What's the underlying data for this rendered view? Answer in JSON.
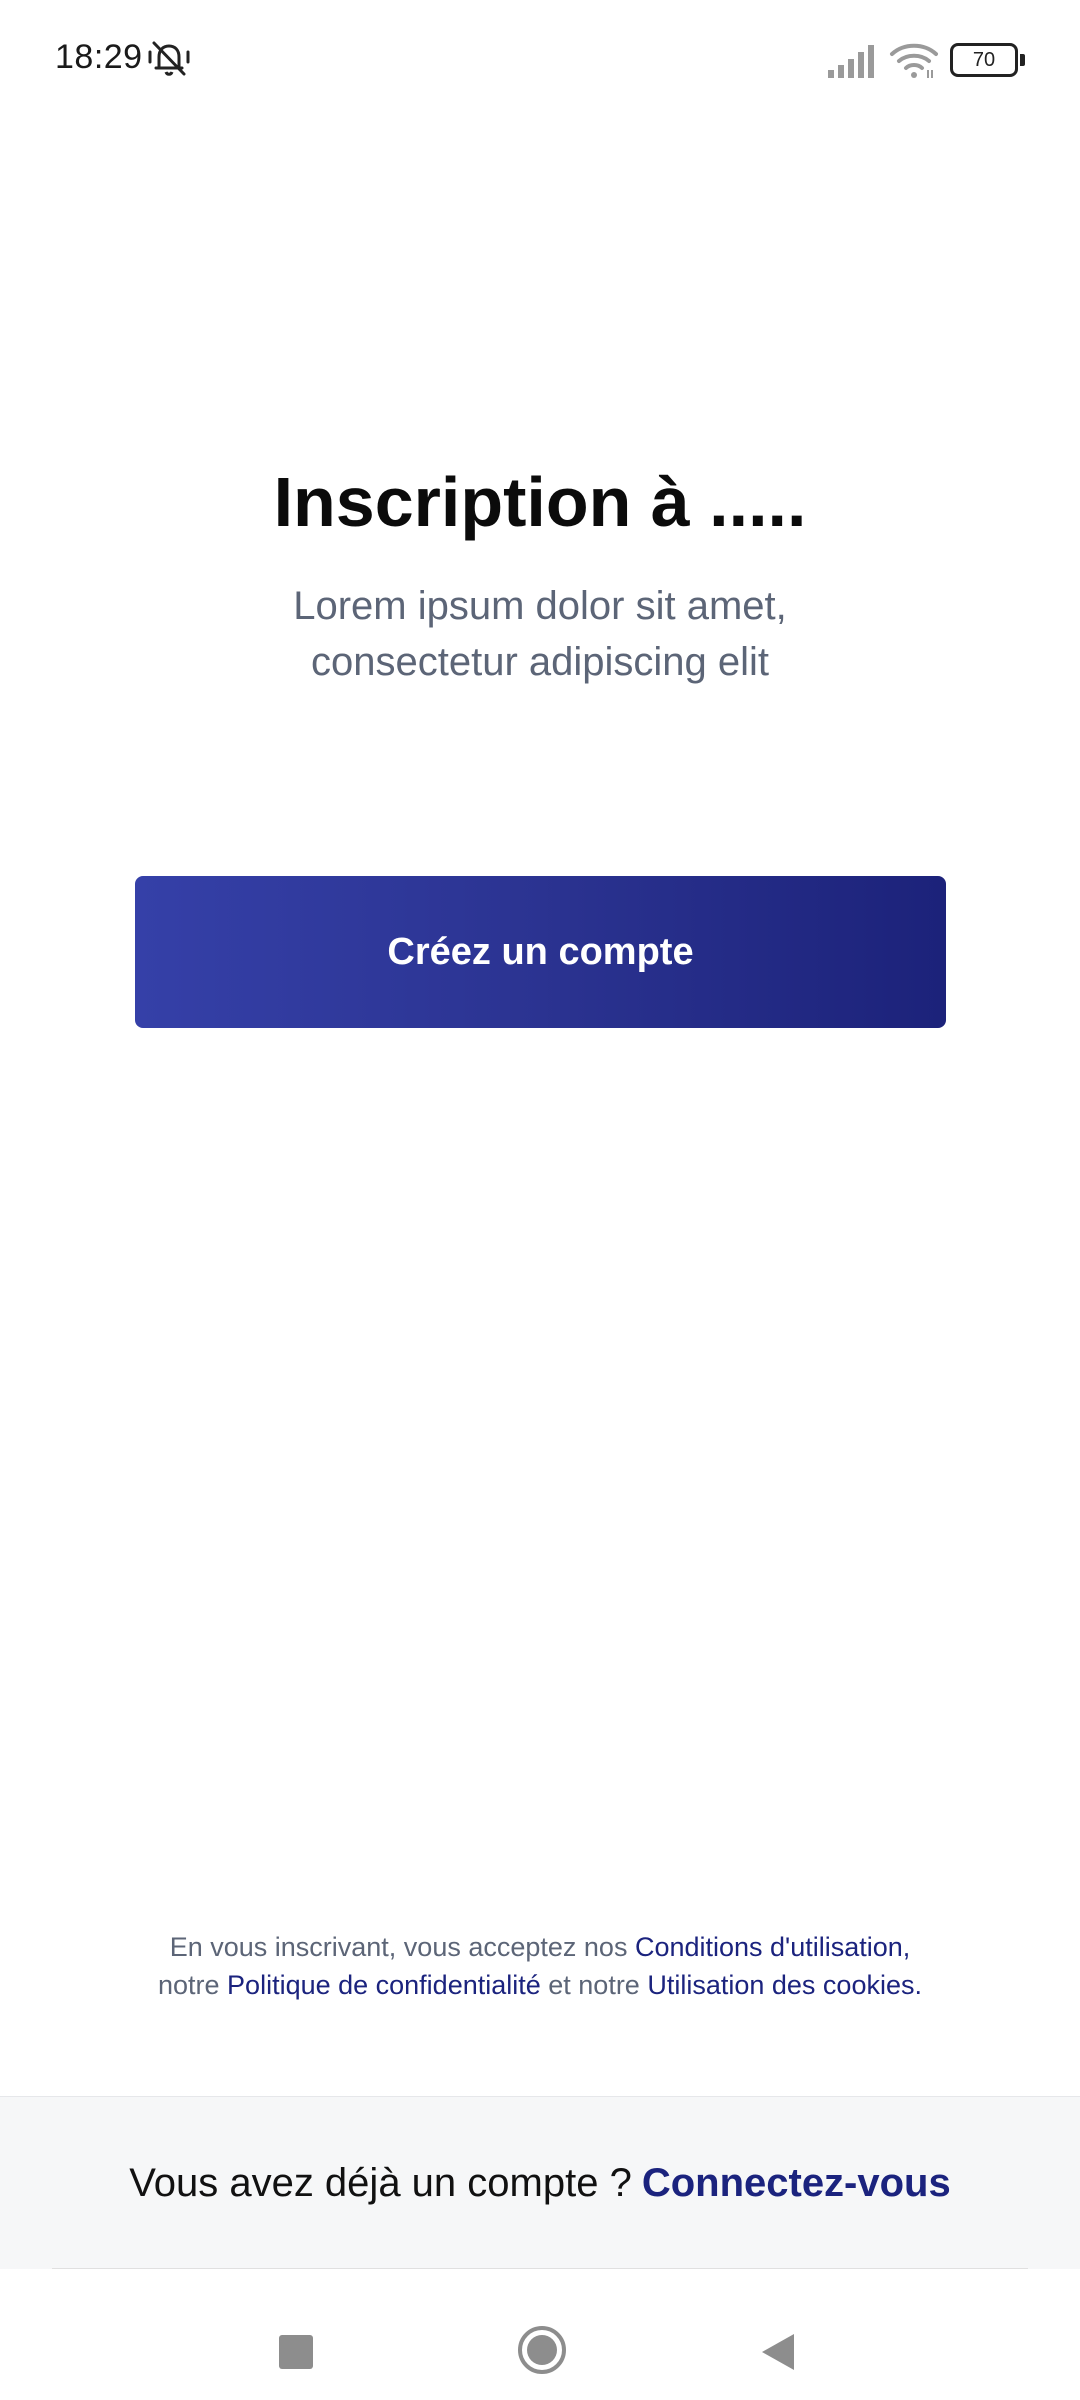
{
  "status_bar": {
    "time": "18:29",
    "left_icon": "muted-bell-icon",
    "signal_icon": "signal-icon",
    "wifi_icon": "wifi-icon",
    "battery_level": "70"
  },
  "hero": {
    "title": "Inscription à .....",
    "subtitle": "Lorem ipsum dolor sit amet, consectetur adipiscing elit"
  },
  "create_button": {
    "label": "Créez un compte"
  },
  "terms": {
    "prefix": "En vous inscrivant, vous acceptez nos ",
    "terms_link": "Conditions d'utilisation,",
    "mid1": " notre ",
    "privacy_link": "Politique de confidentialité",
    "mid2": " et notre ",
    "cookies_link": "Utilisation des cookies."
  },
  "login": {
    "prompt": "Vous avez déjà un compte ?",
    "link": "Connectez-vous"
  },
  "nav_bar": {
    "recent_icon": "recent-apps-icon",
    "home_icon": "home-icon",
    "back_icon": "back-icon"
  },
  "colors": {
    "accent": "#1b237e",
    "button_start": "#3540a8",
    "button_end": "#1c227a",
    "muted_text": "#5c6577",
    "strip_background": "#f6f7f8"
  }
}
